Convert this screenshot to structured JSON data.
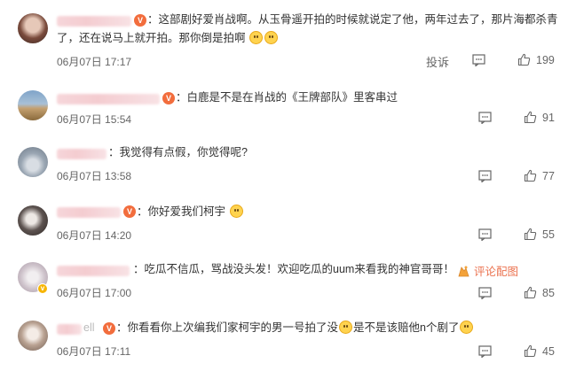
{
  "comments": [
    {
      "text_line1": "：这部剧好爱肖战啊。从玉骨遥开拍的时候就说定了他，两年过去了，那片海都杀青",
      "text_line2": "了，还在说马上就开拍。那你倒是拍啊",
      "time": "06月07日 17:17",
      "report_label": "投诉",
      "likes": "199"
    },
    {
      "text": "：白鹿是不是在肖战的《王牌部队》里客串过",
      "time": "06月07日 15:54",
      "likes": "91"
    },
    {
      "text": "：我觉得有点假，你觉得呢?",
      "time": "06月07日 13:58",
      "likes": "77"
    },
    {
      "text": "：你好爱我们柯宇",
      "time": "06月07日 14:20",
      "likes": "55"
    },
    {
      "text": "：吃瓜不信瓜，骂战没头发！欢迎吃瓜的uum来看我的神官哥哥！",
      "comment_pic_label": "评论配图",
      "time": "06月07日 17:00",
      "likes": "85"
    },
    {
      "text_part1": "：你看看你上次编我们家柯宇的男一号拍了没",
      "text_part2": "是不是该赔他n个剧了",
      "name_suffix": "ell",
      "time": "06月07日 17:11",
      "likes": "45"
    }
  ],
  "colors": {
    "accent": "#eb7350",
    "text": "#333333",
    "muted": "#666666",
    "avatar_badge": "#f26d3d"
  },
  "icons": [
    "comment-icon",
    "like-icon",
    "image-icon",
    "verified-badge-icon",
    "emoji-grin-icon"
  ]
}
